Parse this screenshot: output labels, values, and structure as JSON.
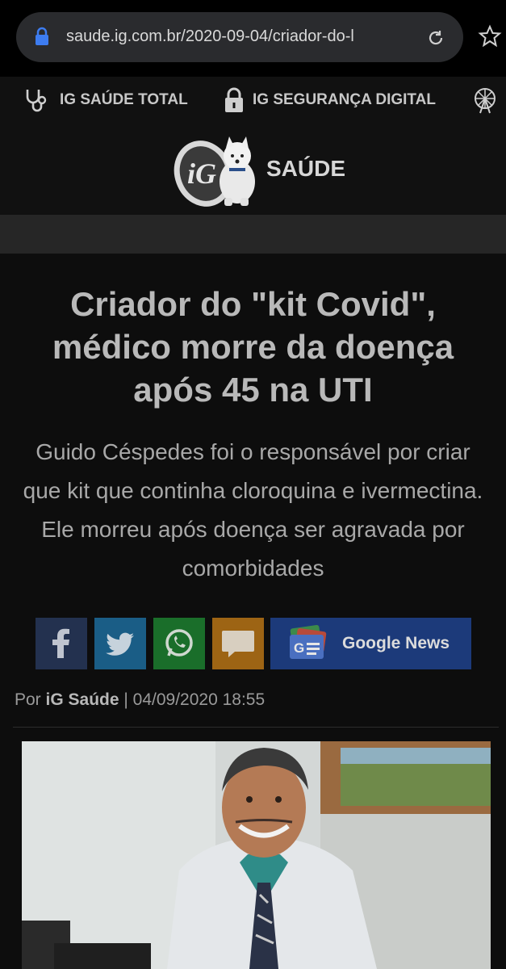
{
  "browser": {
    "url": "saude.ig.com.br/2020-09-04/criador-do-l"
  },
  "topnav": {
    "items": [
      {
        "label": "IG SAÚDE TOTAL",
        "icon": "stethoscope-icon"
      },
      {
        "label": "IG SEGURANÇA DIGITAL",
        "icon": "padlock-icon"
      },
      {
        "label": "",
        "icon": "ferris-wheel-icon"
      }
    ]
  },
  "logo": {
    "mark": "iG",
    "section": "SAÚDE"
  },
  "article": {
    "headline": "Criador do \"kit Covid\", médico morre da doença após 45 na UTI",
    "subtitle": "Guido Céspedes foi o responsável por criar que kit que continha cloroquina e ivermectina. Ele morreu após doença ser agravada por comorbidades",
    "byline_prefix": "Por ",
    "byline_author": "iG Saúde",
    "byline_sep": " | ",
    "byline_date": "04/09/2020 18:55"
  },
  "share": {
    "facebook_icon": "facebook-icon",
    "twitter_icon": "twitter-icon",
    "whatsapp_icon": "whatsapp-icon",
    "comment_icon": "comment-icon",
    "google_news_label": "Google News"
  },
  "colors": {
    "facebook": "#23314f",
    "twitter": "#1a5d86",
    "whatsapp": "#1a6e2a",
    "comment": "#9d6414",
    "google_news": "#1c3a7a",
    "url_lock": "#3d7cf0"
  }
}
